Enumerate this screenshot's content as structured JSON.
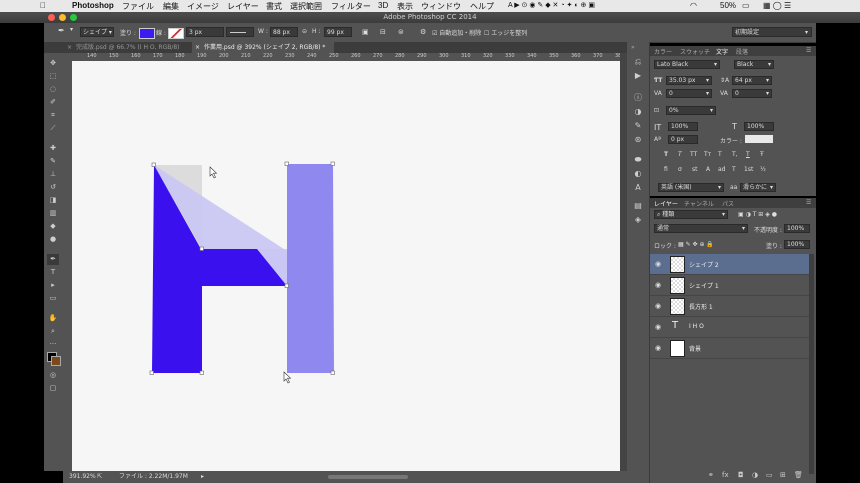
{
  "menubar": {
    "apple": "",
    "items": [
      "Photoshop",
      "ファイル",
      "編集",
      "イメージ",
      "レイヤー",
      "書式",
      "選択範囲",
      "フィルター",
      "3D",
      "表示",
      "ウィンドウ",
      "ヘルプ"
    ],
    "battery": "50%"
  },
  "window": {
    "title": "Adobe Photoshop CC 2014"
  },
  "options": {
    "mode": "シェイプ",
    "fill_label": "塗り :",
    "stroke_label": "線 :",
    "stroke_size": "3 px",
    "w_label": "W :",
    "w_value": "88 px",
    "h_label": "H :",
    "h_value": "99 px",
    "auto_add": "自動追加・削除",
    "align_edges": "エッジを整列",
    "workspace": "初期設定",
    "fill_color": "#3a1cf2",
    "stroke_color": "#d03030"
  },
  "tabs": [
    {
      "label": "完成版.psd @ 66.7% (I H O, RGB/8)",
      "active": false
    },
    {
      "label": "作業用.psd @ 392% (シェイプ 2, RGB/8) *",
      "active": true
    }
  ],
  "ruler": {
    "ticks": [
      "140",
      "150",
      "160",
      "170",
      "180",
      "190",
      "200",
      "210",
      "220",
      "230",
      "240",
      "250",
      "260",
      "270",
      "280",
      "290",
      "300",
      "310",
      "320",
      "330",
      "340",
      "350",
      "360",
      "370",
      "380"
    ]
  },
  "status": {
    "zoom": "391.92%",
    "file": "ファイル : 2.22M/1.97M"
  },
  "character_panel": {
    "tabs": [
      "カラー",
      "スウォッチ",
      "文字",
      "段落"
    ],
    "font_family": "Lato Black",
    "font_style": "Black",
    "font_size": "35.03 px",
    "leading": "64 px",
    "kerning": "0",
    "tracking": "0",
    "tsume": "0%",
    "v_scale": "100%",
    "h_scale": "100%",
    "baseline": "0 px",
    "color_label": "カラー :",
    "type_buttons": [
      "T",
      "T",
      "TT",
      "Tт",
      "T",
      "T,",
      "T",
      "Ŧ"
    ],
    "ot_buttons": [
      "fi",
      "σ",
      "st",
      "A",
      "ad",
      "T",
      "1st",
      "½"
    ],
    "language": "英語 (米国)",
    "antialias": "滑らかに",
    "aa_prefix": "aa"
  },
  "layers_panel": {
    "tabs": [
      "レイヤー",
      "チャンネル",
      "パス"
    ],
    "filter": "種類",
    "blend": "通常",
    "opacity_label": "不透明度 :",
    "opacity": "100%",
    "lock_label": "ロック :",
    "fill_label": "塗り :",
    "fill": "100%",
    "layers": [
      {
        "name": "シェイプ 2",
        "type": "shape",
        "selected": true
      },
      {
        "name": "シェイプ 1",
        "type": "shape",
        "selected": false
      },
      {
        "name": "長方形 1",
        "type": "shape",
        "selected": false
      },
      {
        "name": "I H O",
        "type": "text",
        "selected": false
      },
      {
        "name": "背景",
        "type": "background",
        "selected": false
      }
    ],
    "footer_icons": [
      "link-icon",
      "fx-icon",
      "mask-icon",
      "adjustment-icon",
      "group-icon",
      "new-layer-icon",
      "trash-icon"
    ]
  },
  "toolbar": {
    "tools": [
      "move-icon",
      "marquee-icon",
      "lasso-icon",
      "quick-select-icon",
      "crop-icon",
      "eyedropper-icon",
      "healing-icon",
      "brush-icon",
      "stamp-icon",
      "history-brush-icon",
      "eraser-icon",
      "gradient-icon",
      "blur-icon",
      "dodge-icon",
      "pen-icon",
      "type-icon",
      "path-select-icon",
      "rectangle-icon",
      "hand-icon",
      "zoom-icon"
    ]
  },
  "colors": {
    "shape_dark": "#3a10ee",
    "shape_light": "#8e88ef",
    "shape_pale": "#c9c5f4",
    "ghost": "#dcdcdc"
  }
}
